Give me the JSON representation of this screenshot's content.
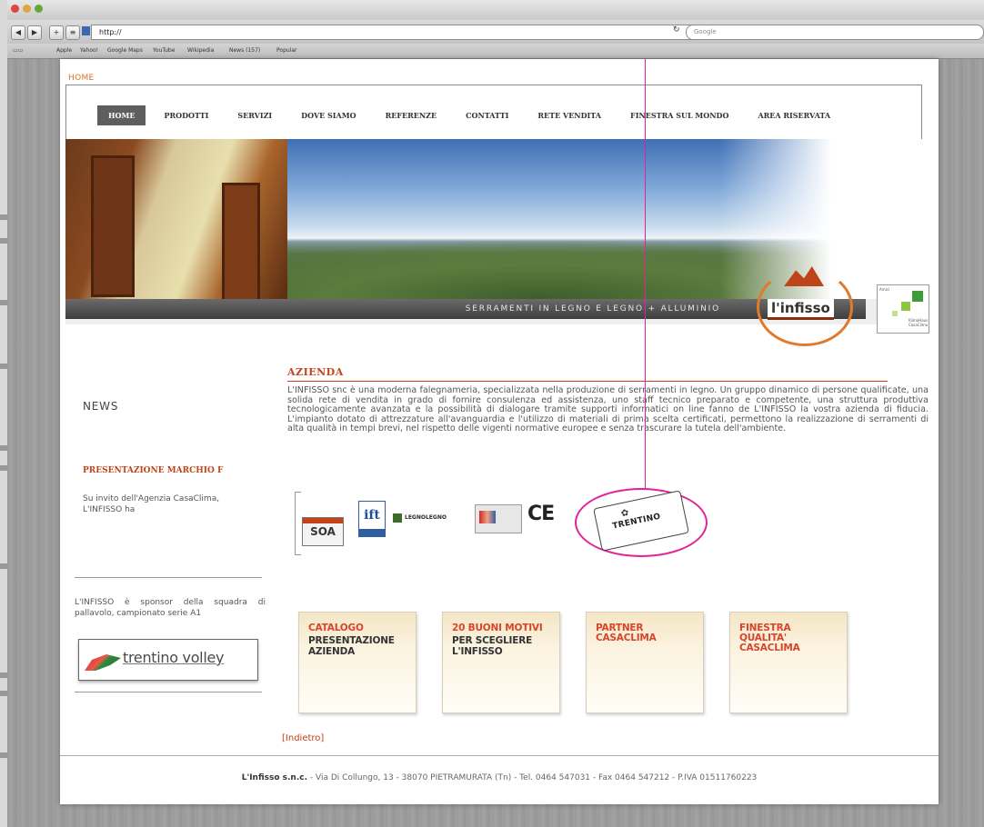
{
  "browser": {
    "url": "http://",
    "search_placeholder": "Google",
    "bookmarks": [
      "Apple",
      "Yahoo!",
      "Google Maps",
      "YouTube",
      "Wikipedia",
      "News (157)",
      "Popular"
    ]
  },
  "site": {
    "breadcrumb": "HOME",
    "menu": [
      {
        "label": "HOME",
        "active": true
      },
      {
        "label": "PRODOTTI"
      },
      {
        "label": "SERVIZI"
      },
      {
        "label": "DOVE SIAMO"
      },
      {
        "label": "REFERENZE"
      },
      {
        "label": "CONTATTI"
      },
      {
        "label": "RETE VENDITA"
      },
      {
        "label": "FINESTRA SUL MONDO"
      },
      {
        "label": "AREA RISERVATA"
      }
    ],
    "banner": {
      "tagline": "SERRAMENTI IN LEGNO E LEGNO + ALLUMINIO",
      "logo_text": "l'infisso"
    },
    "sidebar": {
      "news_heading": "NEWS",
      "news_title": "PRESENTAZIONE MARCHIO F",
      "news_excerpt": "Su invito dell'Agenzia CasaClima, L'INFISSO ha",
      "sponsor_text": "L'INFISSO è sponsor della squadra di pallavolo, campionato serie A1",
      "volley_logo": "trentino volley"
    },
    "azienda": {
      "heading": "AZIENDA",
      "text": "L'INFISSO snc è una moderna falegnameria, specializzata nella produzione di serramenti in legno. Un gruppo dinamico di persone qualificate, una solida rete di vendita in grado di fornire consulenza ed assistenza, uno staff tecnico preparato e competente, una struttura produttiva tecnologicamente avanzata e la possibilità di dialogare tramite supporti informatici on line fanno de L'INFISSO la vostra azienda di fiducia. L'impianto dotato di attrezzature all'avanguardia e l'utilizzo di materiali di prima scelta certificati, permettono la realizzazione di serramenti di alta qualità in tempi brevi, nel rispetto delle vigenti normative europee e senza trascurare la tutela dell'ambiente."
    },
    "certifications": {
      "soa": "SOA",
      "ift": "ift",
      "legnolegno": "LEGNOLEGNO",
      "ce": "CE",
      "trentino": "TRENTINO"
    },
    "buttons": [
      {
        "line1": "CATALOGO",
        "line2": "PRESENTAZIONE AZIENDA"
      },
      {
        "line1": "20 BUONI MOTIVI",
        "line2": "PER SCEGLIERE L'INFISSO"
      },
      {
        "line1": "PARTNER CASACLIMA",
        "line2": ""
      },
      {
        "line1": "FINESTRA QUALITA' CASACLIMA",
        "line2": ""
      }
    ],
    "back_link": "[Indietro]",
    "footer": {
      "company": "L'Infisso s.n.c.",
      "details": " - Via Di Collungo, 13 - 38070 PIETRAMURATA (Tn) - Tel. 0464 547031 - Fax 0464 547212 - P.IVA 01511760223"
    }
  },
  "colors": {
    "accent": "#c3421a",
    "annotation": "#e0239b"
  }
}
